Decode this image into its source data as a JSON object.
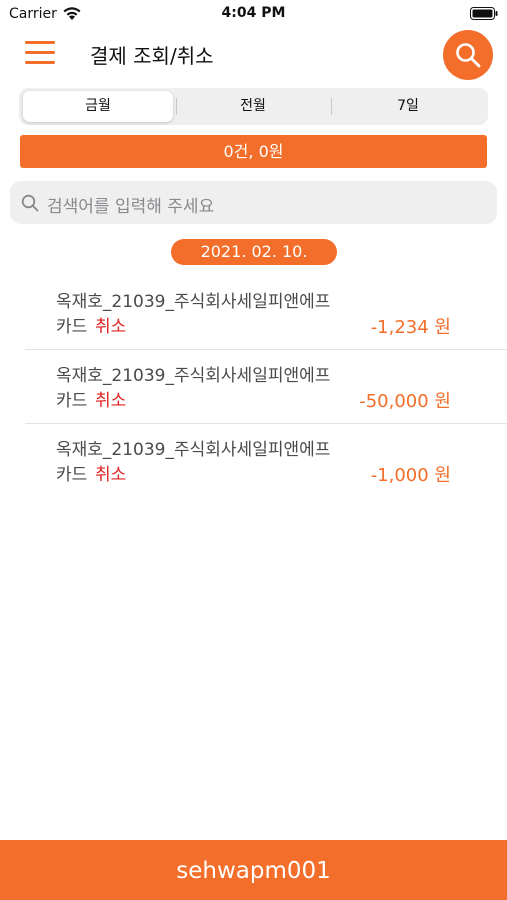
{
  "status_bar": {
    "carrier": "Carrier",
    "time": "4:04 PM"
  },
  "header": {
    "title": "결제 조회/취소"
  },
  "tabs": [
    {
      "label": "금월",
      "selected": true
    },
    {
      "label": "전월",
      "selected": false
    },
    {
      "label": "7일",
      "selected": false
    }
  ],
  "summary": {
    "text": "0건, 0원"
  },
  "search": {
    "placeholder": "검색어를 입력해 주세요"
  },
  "date_group": {
    "date": "2021. 02. 10."
  },
  "transactions": [
    {
      "name": "옥재호_21039_주식회사세일피앤에프",
      "type": "카드",
      "status": "취소",
      "amount": "-1,234 원"
    },
    {
      "name": "옥재호_21039_주식회사세일피앤에프",
      "type": "카드",
      "status": "취소",
      "amount": "-50,000 원"
    },
    {
      "name": "옥재호_21039_주식회사세일피앤에프",
      "type": "카드",
      "status": "취소",
      "amount": "-1,000 원"
    }
  ],
  "footer": {
    "user_id": "sehwapm001"
  },
  "colors": {
    "accent": "#f36e2a",
    "cancel_red": "#e02323",
    "text_gray": "#4a4a4a"
  },
  "icons": [
    "wifi-icon",
    "battery-icon",
    "hamburger-menu-icon",
    "search-icon",
    "magnifier-icon"
  ]
}
